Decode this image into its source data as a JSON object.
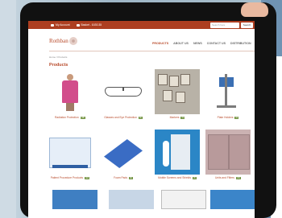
{
  "topbar": {
    "my_account": "My Account",
    "basket": "Basket - £430.35",
    "search_placeholder": "Search here",
    "search_button": "Search"
  },
  "brand": {
    "logo_text": "Rothban"
  },
  "nav": {
    "items": [
      "PRODUCTS",
      "ABOUT US",
      "NEWS",
      "CONTACT US",
      "DISTRIBUTION"
    ],
    "active": "PRODUCTS"
  },
  "breadcrumb": "Home / Products",
  "page_title": "Products",
  "products": [
    {
      "name": "Radiation Protection",
      "badge": "(48)"
    },
    {
      "name": "Glasses and Eye Protection",
      "badge": "(9)"
    },
    {
      "name": "Markers",
      "badge": "(9)"
    },
    {
      "name": "Plate Holders",
      "badge": "(9)"
    },
    {
      "name": "Patient Procedure Products",
      "badge": "(12)"
    },
    {
      "name": "Foam Pads",
      "badge": "(6)"
    },
    {
      "name": "Mobile Screens and Shields",
      "badge": "(3)"
    },
    {
      "name": "Units and Filters",
      "badge": "(13)"
    }
  ],
  "colors": {
    "brand_red": "#b84a2a",
    "topbar": "#ad3e20",
    "badge_green": "#6d8f3a"
  }
}
